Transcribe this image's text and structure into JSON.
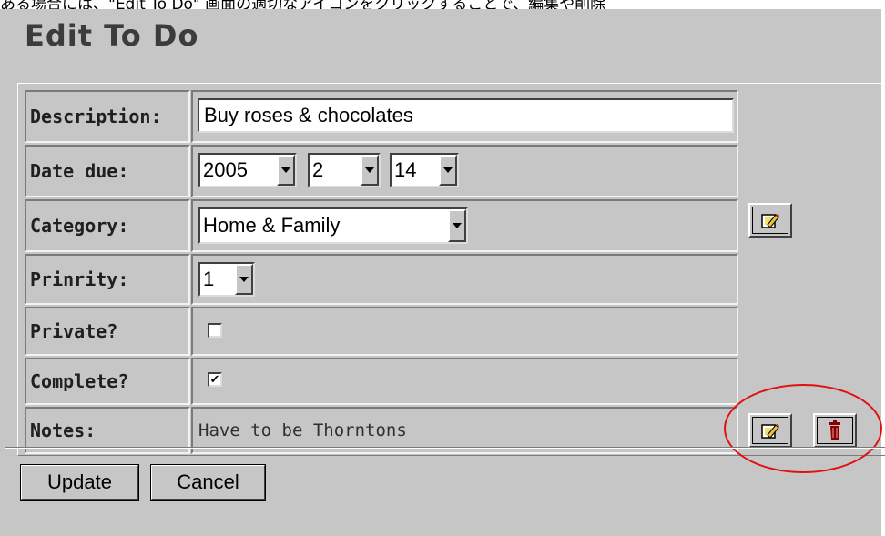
{
  "page_heading_partial": "ある場合には、\"Edit To Do\" 画面の適切なアイコンをクリックすることで、編集や削除",
  "title": "Edit To Do",
  "rows": {
    "description": {
      "label": "Description:",
      "value": "Buy roses & chocolates"
    },
    "date_due": {
      "label": "Date due:",
      "year": "2005",
      "month": "2",
      "day": "14"
    },
    "category": {
      "label": "Category:",
      "value": "Home & Family",
      "edit_icon": "edit-icon"
    },
    "priority": {
      "label": "Prinrity:",
      "value": "1"
    },
    "private": {
      "label": "Private?",
      "checked": false
    },
    "complete": {
      "label": "Complete?",
      "checked": true,
      "check_glyph": "✔"
    },
    "notes": {
      "label": "Notes:",
      "value": "Have to be Thorntons",
      "edit_icon": "edit-icon",
      "delete_icon": "trash-icon"
    }
  },
  "buttons": {
    "update": "Update",
    "cancel": "Cancel"
  },
  "colors": {
    "panel": "#c6c6c6",
    "title": "#3c3c3c",
    "callout": "#e01010",
    "trash": "#8b0000"
  }
}
